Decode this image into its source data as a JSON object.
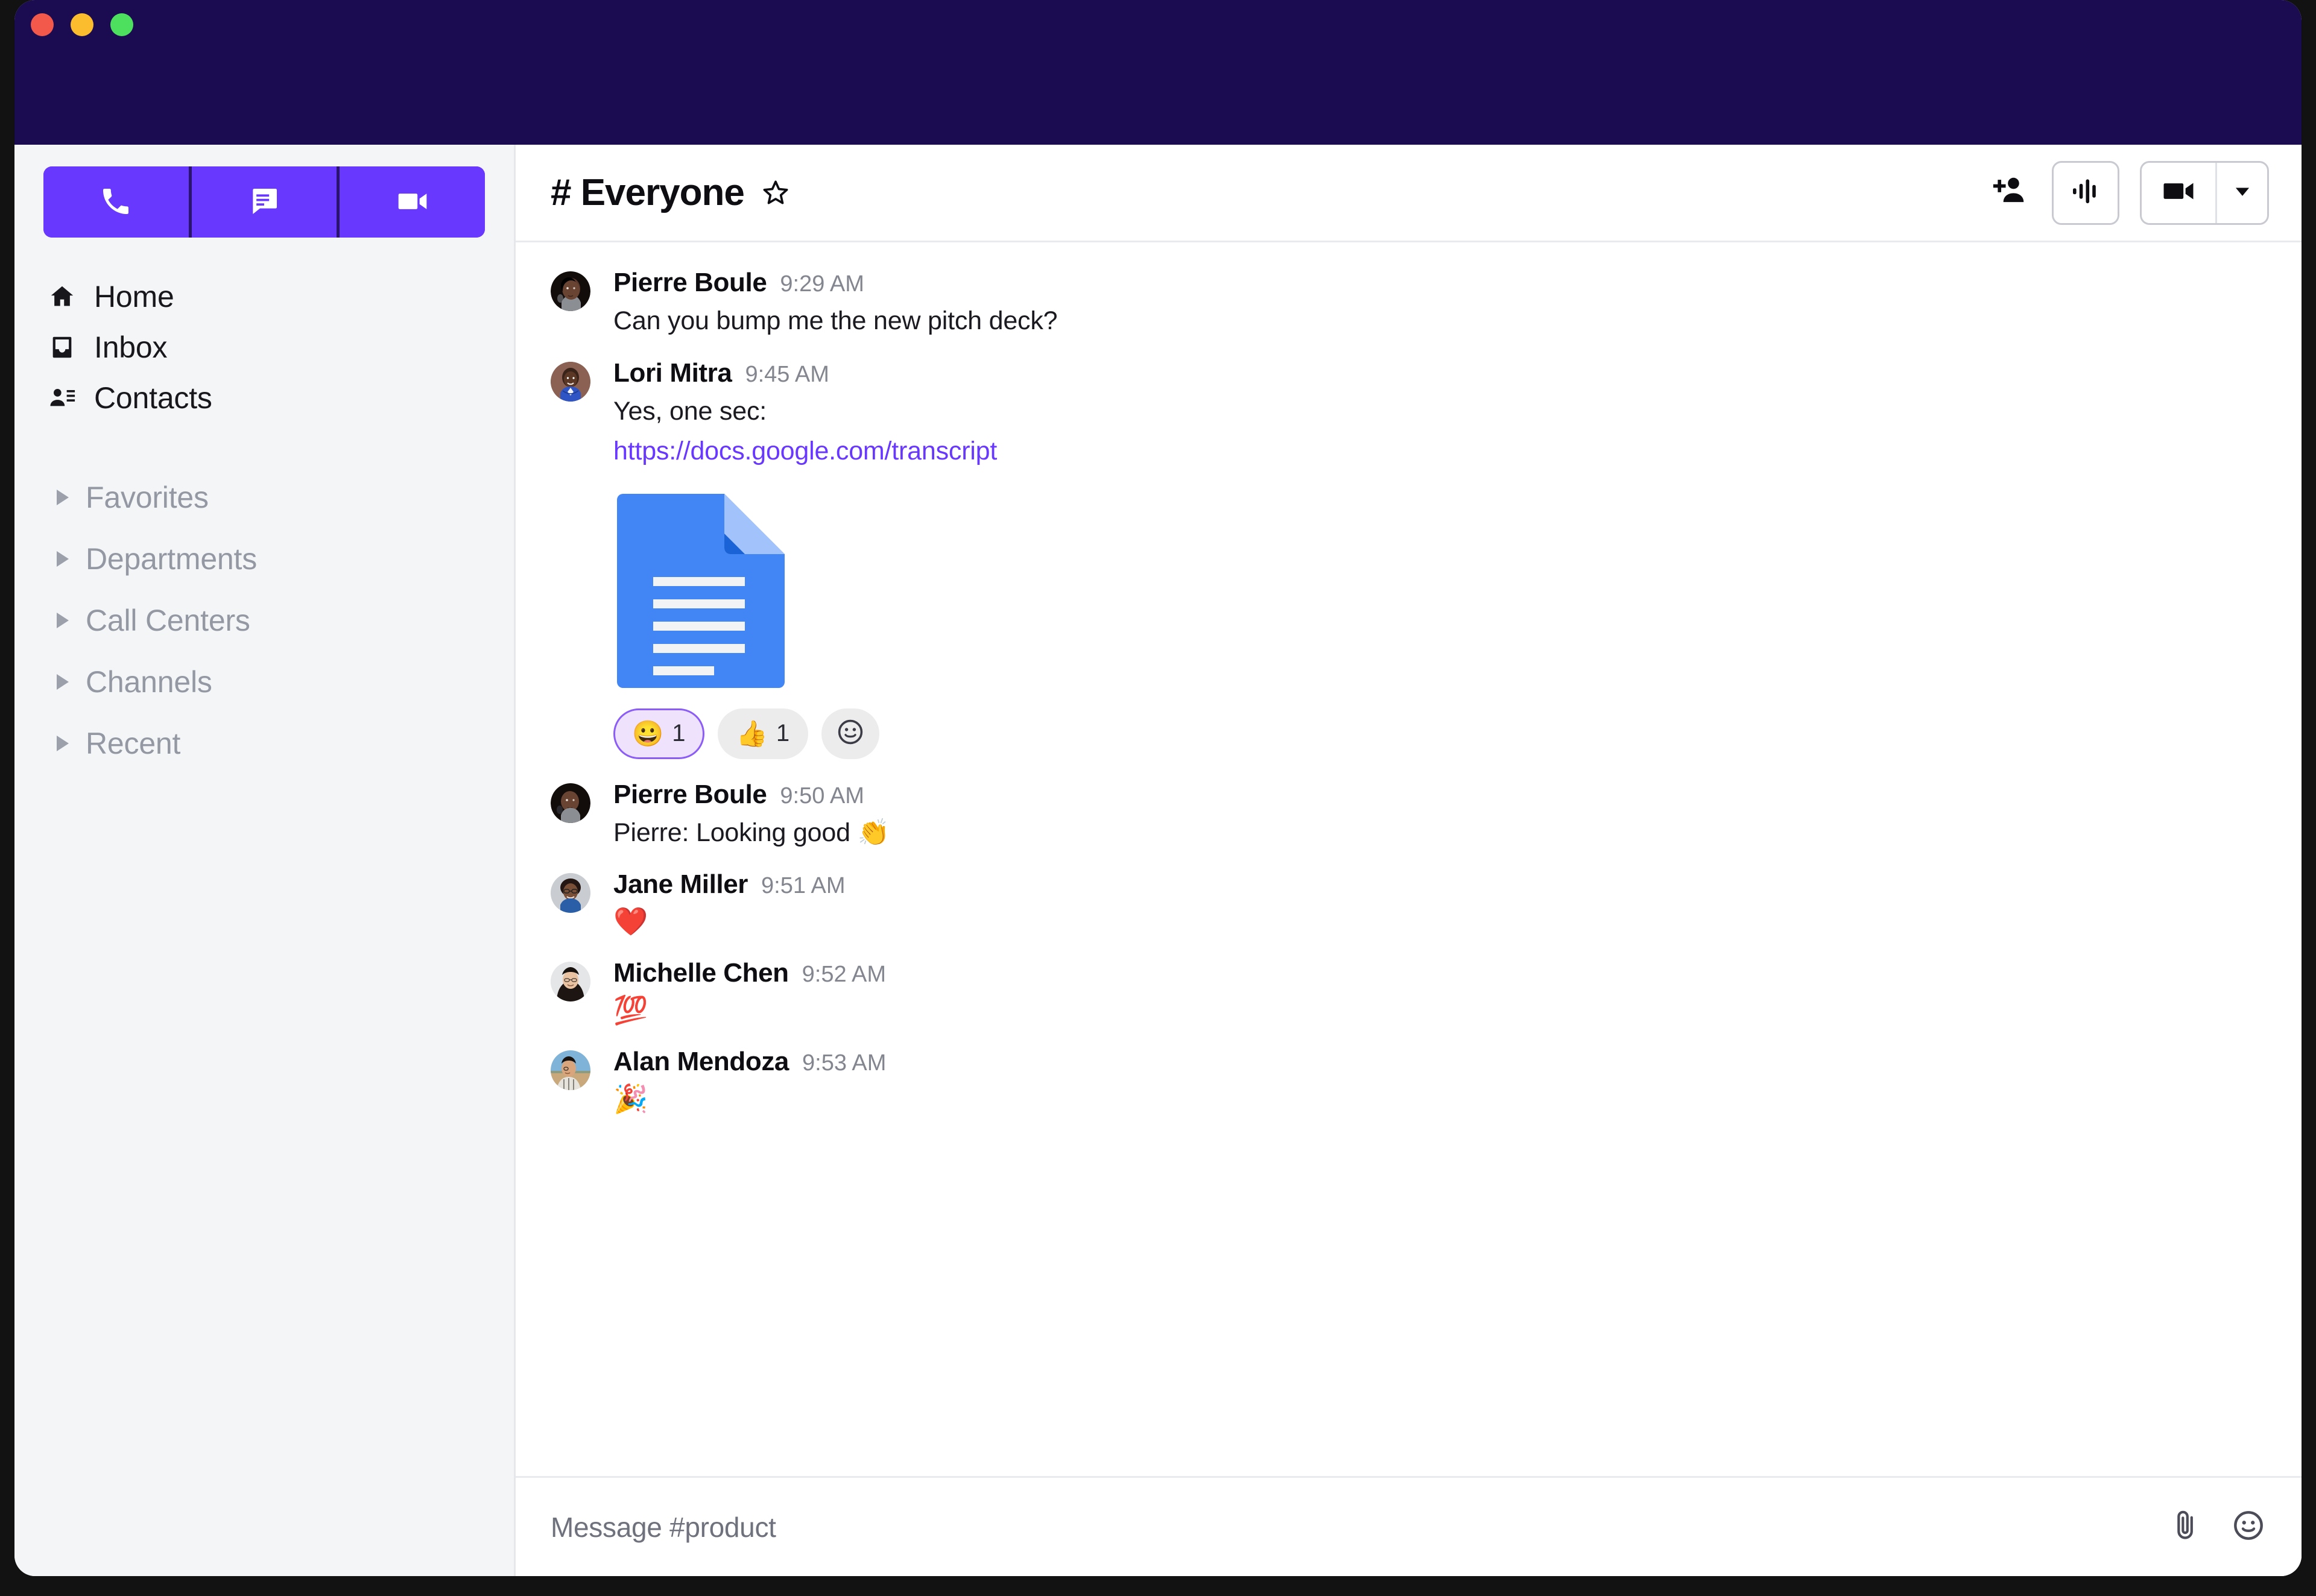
{
  "window": {
    "titlebar_color": "#1b0b50",
    "traffic_lights": [
      "close",
      "minimize",
      "maximize"
    ]
  },
  "theme": {
    "accent": "#6938FF",
    "link": "#6938FF",
    "sidebar_bg": "#F4F5F7",
    "reaction_active_bg": "#EEE2FD",
    "reaction_active_border": "#8B5CF6",
    "reaction_bg": "#ECECED"
  },
  "sidebar": {
    "actions": [
      {
        "name": "phone-icon",
        "label": "Call"
      },
      {
        "name": "chat-icon",
        "label": "Message"
      },
      {
        "name": "video-icon",
        "label": "Video"
      }
    ],
    "nav": [
      {
        "label": "Home",
        "icon": "home-icon"
      },
      {
        "label": "Inbox",
        "icon": "inbox-icon"
      },
      {
        "label": "Contacts",
        "icon": "contacts-icon"
      }
    ],
    "groups": [
      {
        "label": "Favorites"
      },
      {
        "label": "Departments"
      },
      {
        "label": "Call Centers"
      },
      {
        "label": "Channels"
      },
      {
        "label": "Recent"
      }
    ]
  },
  "header": {
    "hash": "#",
    "channel": "Everyone",
    "title": "# Everyone",
    "star_icon": "star-outline-icon",
    "actions": [
      {
        "name": "add-person-icon",
        "label": "Add people"
      },
      {
        "name": "audio-waveform-icon",
        "label": "Start audio"
      },
      {
        "name": "video-camera-icon",
        "label": "Start video"
      },
      {
        "name": "chevron-down-icon",
        "label": "Video options"
      }
    ]
  },
  "messages": [
    {
      "author": "Pierre Boule",
      "time": "9:29 AM",
      "text": "Can you bump me the new pitch deck?",
      "avatar": "pierre"
    },
    {
      "author": "Lori Mitra",
      "time": "9:45 AM",
      "text": "Yes, one sec:",
      "link": "https://docs.google.com/transcript",
      "attachment": "google-docs-file",
      "avatar": "lori",
      "reactions": [
        {
          "emoji": "😀",
          "count": "1",
          "active": true
        },
        {
          "emoji": "👍",
          "count": "1",
          "active": false
        },
        {
          "emoji": "add",
          "count": "",
          "active": false
        }
      ]
    },
    {
      "author": "Pierre Boule",
      "time": "9:50 AM",
      "text": "Pierre: Looking good 👏",
      "avatar": "pierre"
    },
    {
      "author": "Jane Miller",
      "time": "9:51 AM",
      "emoji_text": "❤️",
      "avatar": "jane"
    },
    {
      "author": "Michelle Chen",
      "time": "9:52 AM",
      "emoji_text": "💯",
      "avatar": "michelle"
    },
    {
      "author": "Alan Mendoza",
      "time": "9:53 AM",
      "emoji_text": "🎉",
      "avatar": "alan"
    }
  ],
  "composer": {
    "placeholder": "Message #product",
    "value": "",
    "actions": [
      {
        "name": "paperclip-icon",
        "label": "Attach file"
      },
      {
        "name": "emoji-icon",
        "label": "Insert emoji"
      }
    ]
  }
}
